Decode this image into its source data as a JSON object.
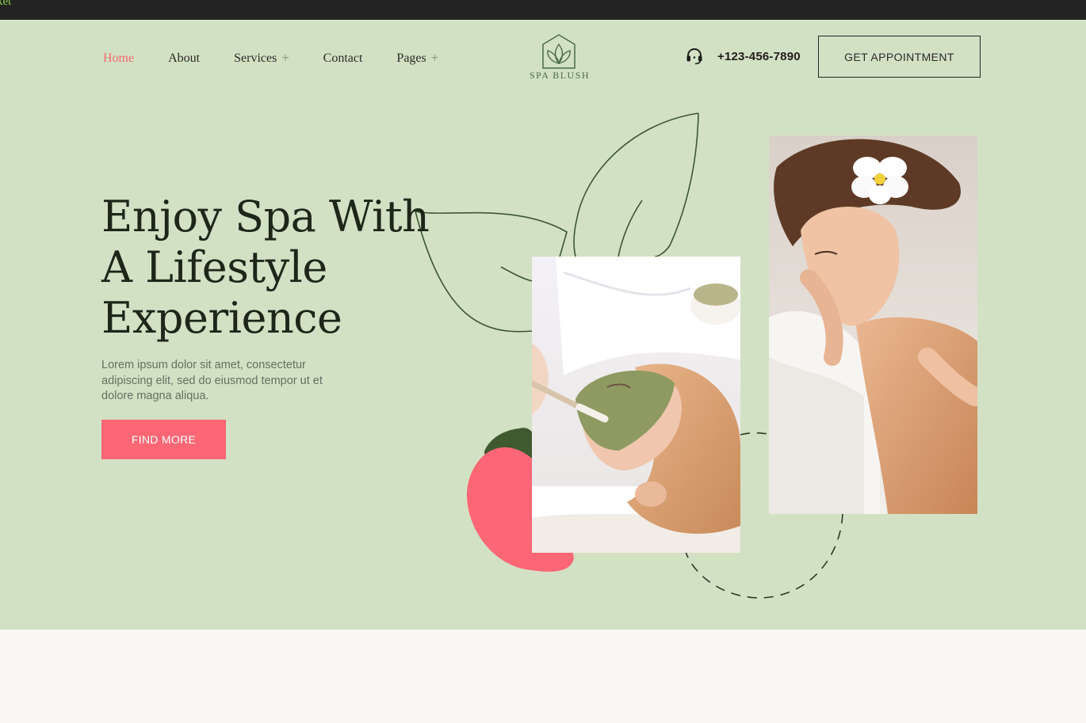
{
  "topbar": {
    "text": "ket"
  },
  "nav": {
    "items": [
      {
        "label": "Home",
        "active": true,
        "has_submenu": false
      },
      {
        "label": "About",
        "active": false,
        "has_submenu": false
      },
      {
        "label": "Services",
        "active": false,
        "has_submenu": true
      },
      {
        "label": "Contact",
        "active": false,
        "has_submenu": false
      },
      {
        "label": "Pages",
        "active": false,
        "has_submenu": true
      }
    ],
    "submenu_icon": "+"
  },
  "logo": {
    "text": "SPA BLUSH",
    "icon": "lotus-house-icon"
  },
  "contact": {
    "phone": "+123-456-7890",
    "icon": "headset-icon"
  },
  "appointment_button": {
    "label": "GET APPOINTMENT"
  },
  "hero": {
    "headline_lines": [
      "Enjoy Spa With",
      "A Lifestyle",
      "Experience"
    ],
    "description": "Lorem ipsum dolor sit amet, consectetur adipiscing elit, sed do eiusmod tempor  ut et dolore magna aliqua.",
    "cta_label": "FIND MORE"
  },
  "colors": {
    "hero_bg": "#d2e1c4",
    "accent_pink": "#fd6674",
    "dark_green": "#3e5a2e",
    "text_dark": "#1d2619",
    "page_bg": "#f8f7f4"
  }
}
